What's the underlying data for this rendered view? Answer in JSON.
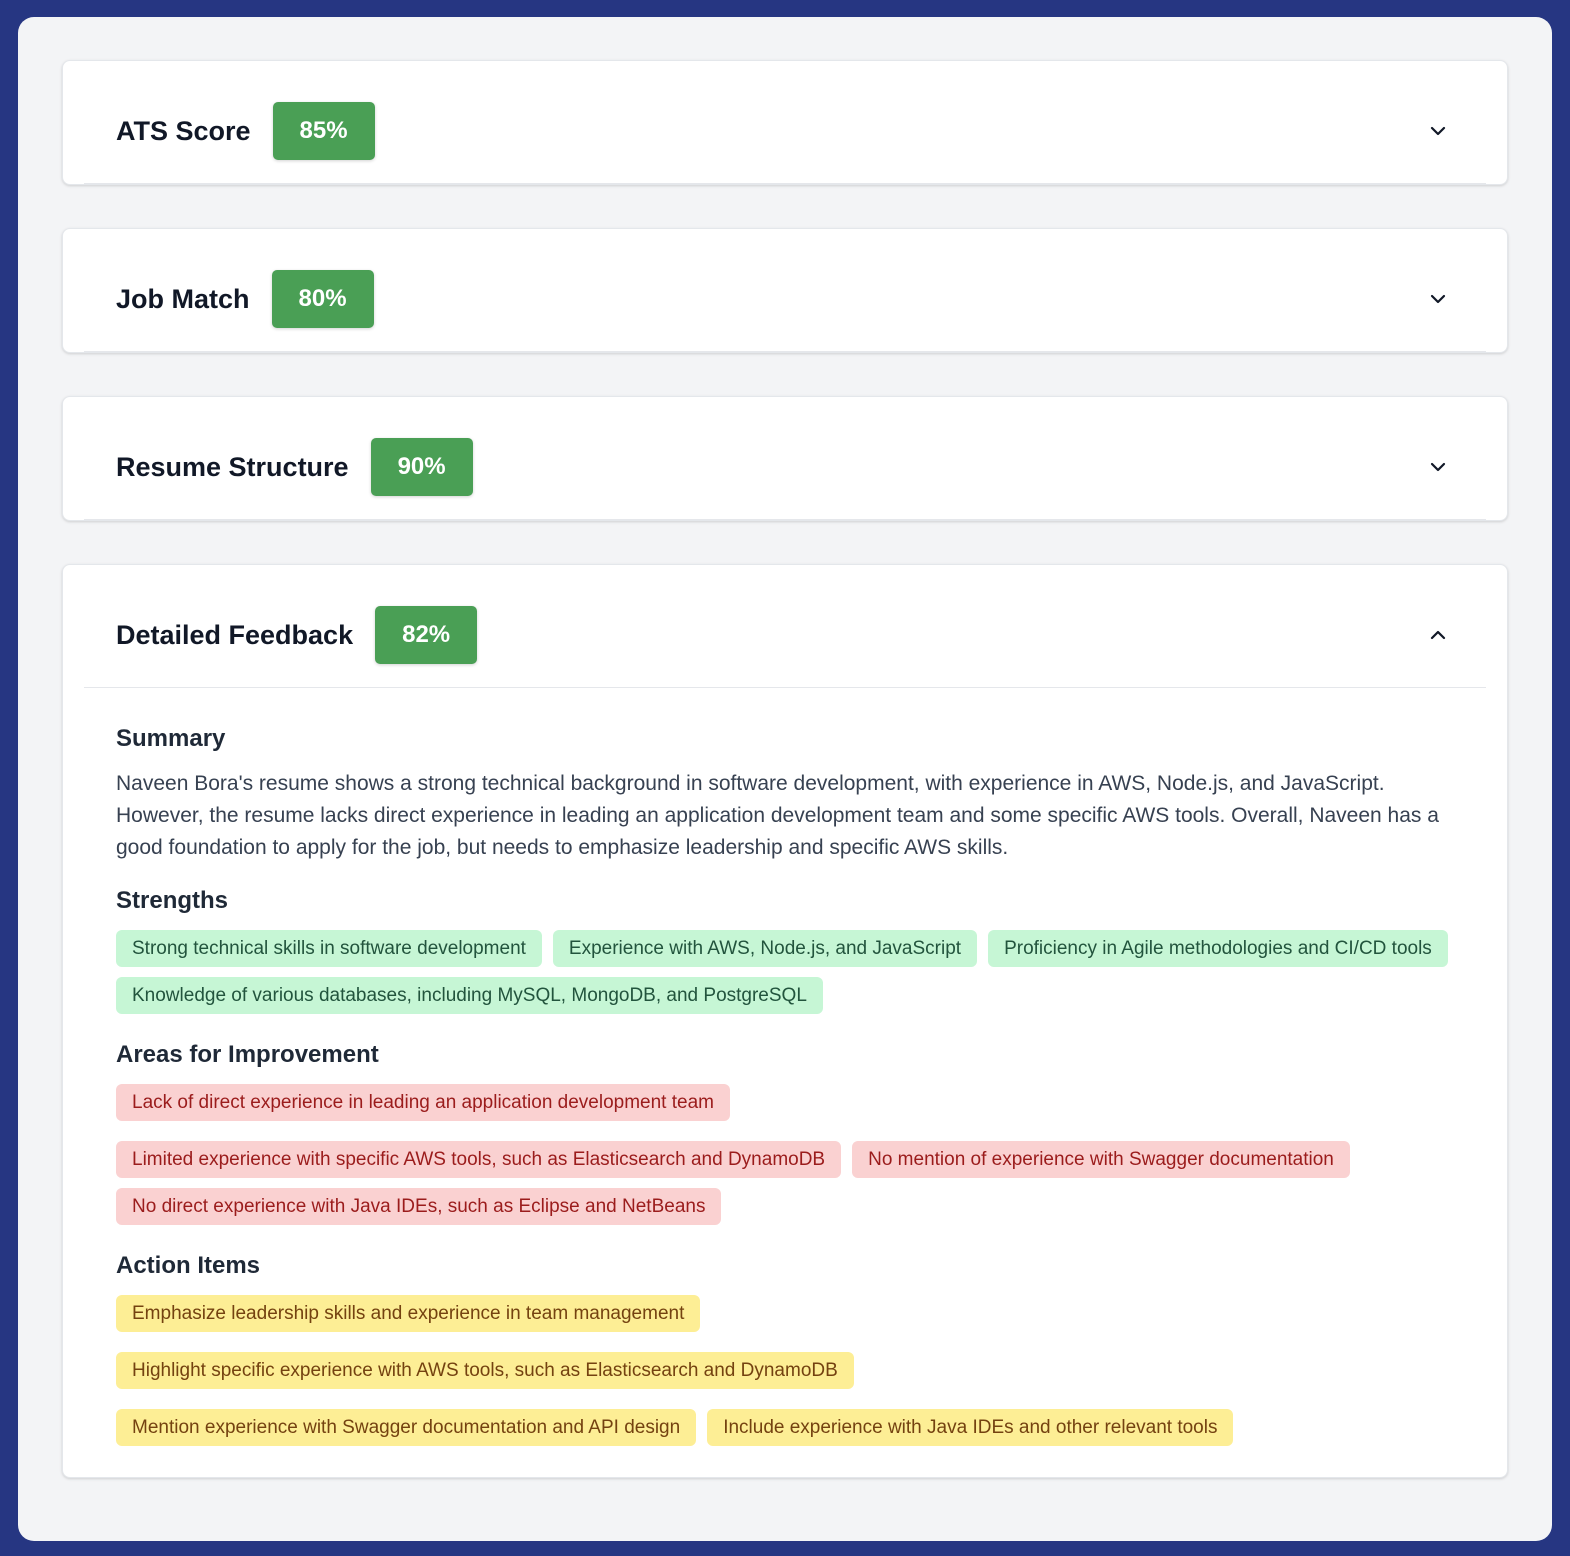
{
  "cards": [
    {
      "title": "ATS Score",
      "score": "85%",
      "expanded": false
    },
    {
      "title": "Job Match",
      "score": "80%",
      "expanded": false
    },
    {
      "title": "Resume Structure",
      "score": "90%",
      "expanded": false
    },
    {
      "title": "Detailed Feedback",
      "score": "82%",
      "expanded": true
    }
  ],
  "feedback": {
    "summary_title": "Summary",
    "summary_text": "Naveen Bora's resume shows a strong technical background in software development, with experience in AWS, Node.js, and JavaScript. However, the resume lacks direct experience in leading an application development team and some specific AWS tools. Overall, Naveen has a good foundation to apply for the job, but needs to emphasize leadership and specific AWS skills.",
    "strengths_title": "Strengths",
    "strengths": [
      "Strong technical skills in software development",
      "Experience with AWS, Node.js, and JavaScript",
      "Proficiency in Agile methodologies and CI/CD tools",
      "Knowledge of various databases, including MySQL, MongoDB, and PostgreSQL"
    ],
    "improvements_title": "Areas for Improvement",
    "improvements": [
      "Lack of direct experience in leading an application development team",
      "Limited experience with specific AWS tools, such as Elasticsearch and DynamoDB",
      "No mention of experience with Swagger documentation",
      "No direct experience with Java IDEs, such as Eclipse and NetBeans"
    ],
    "actions_title": "Action Items",
    "actions": [
      "Emphasize leadership skills and experience in team management",
      "Highlight specific experience with AWS tools, such as Elasticsearch and DynamoDB",
      "Mention experience with Swagger documentation and API design",
      "Include experience with Java IDEs and other relevant tools"
    ]
  },
  "icons": {
    "collapsed": "chevron-down-icon",
    "expanded": "chevron-up-icon"
  },
  "colors": {
    "page_background": "#263682",
    "panel_background": "#f3f4f6",
    "score_badge": "#4a9f55",
    "strength_tag": "#c6f6d5",
    "improvement_tag": "#fad1d1",
    "action_tag": "#fdee95"
  }
}
